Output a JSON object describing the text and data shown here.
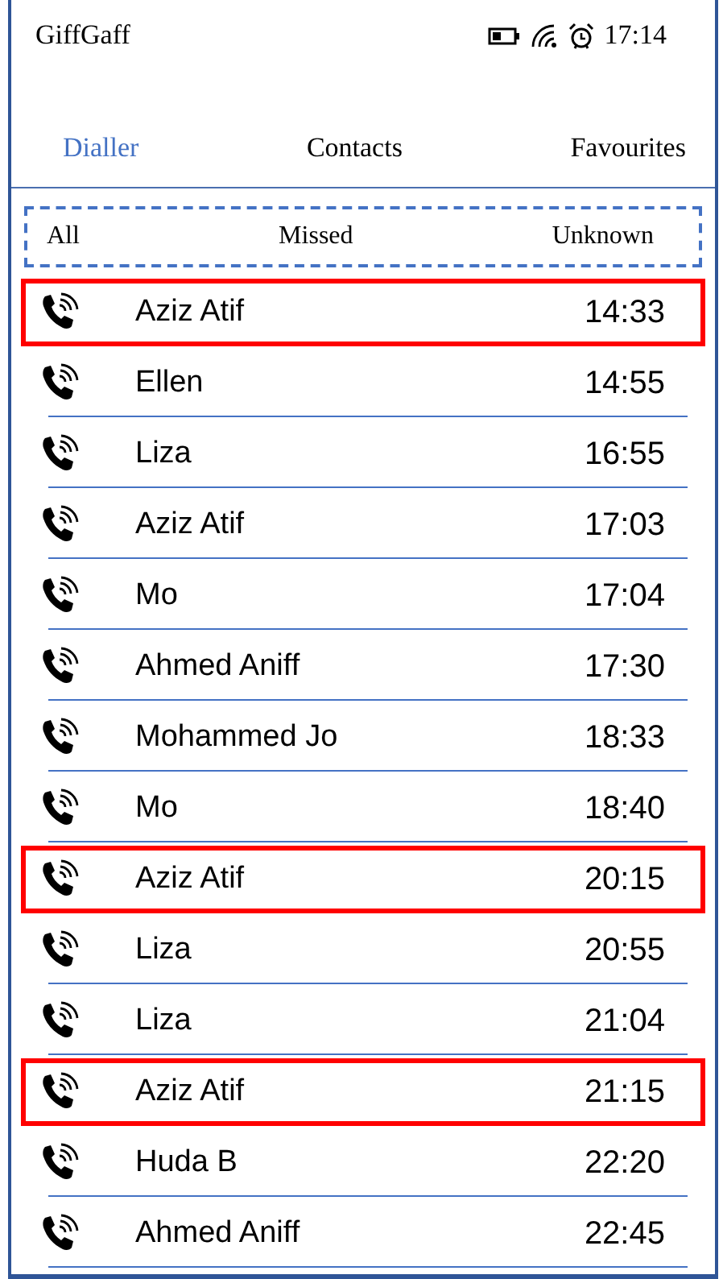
{
  "status_bar": {
    "carrier": "GiffGaff",
    "time": "17:14"
  },
  "tabs": [
    {
      "label": "Dialler",
      "selected": true
    },
    {
      "label": "Contacts",
      "selected": false
    },
    {
      "label": "Favourites",
      "selected": false
    }
  ],
  "filters": [
    {
      "label": "All"
    },
    {
      "label": "Missed"
    },
    {
      "label": "Unknown"
    }
  ],
  "calls": [
    {
      "name": "Aziz Atif",
      "time": "14:33",
      "highlighted": true
    },
    {
      "name": "Ellen",
      "time": "14:55",
      "highlighted": false
    },
    {
      "name": "Liza",
      "time": "16:55",
      "highlighted": false
    },
    {
      "name": "Aziz Atif",
      "time": "17:03",
      "highlighted": false
    },
    {
      "name": "Mo",
      "time": "17:04",
      "highlighted": false
    },
    {
      "name": "Ahmed Aniff",
      "time": "17:30",
      "highlighted": false
    },
    {
      "name": "Mohammed Jo",
      "time": "18:33",
      "highlighted": false
    },
    {
      "name": "Mo",
      "time": "18:40",
      "highlighted": false
    },
    {
      "name": "Aziz Atif",
      "time": "20:15",
      "highlighted": true
    },
    {
      "name": "Liza",
      "time": "20:55",
      "highlighted": false
    },
    {
      "name": "Liza",
      "time": "21:04",
      "highlighted": false
    },
    {
      "name": "Aziz Atif",
      "time": "21:15",
      "highlighted": true
    },
    {
      "name": "Huda B",
      "time": "22:20",
      "highlighted": false
    },
    {
      "name": "Ahmed Aniff",
      "time": "22:45",
      "highlighted": false
    }
  ]
}
